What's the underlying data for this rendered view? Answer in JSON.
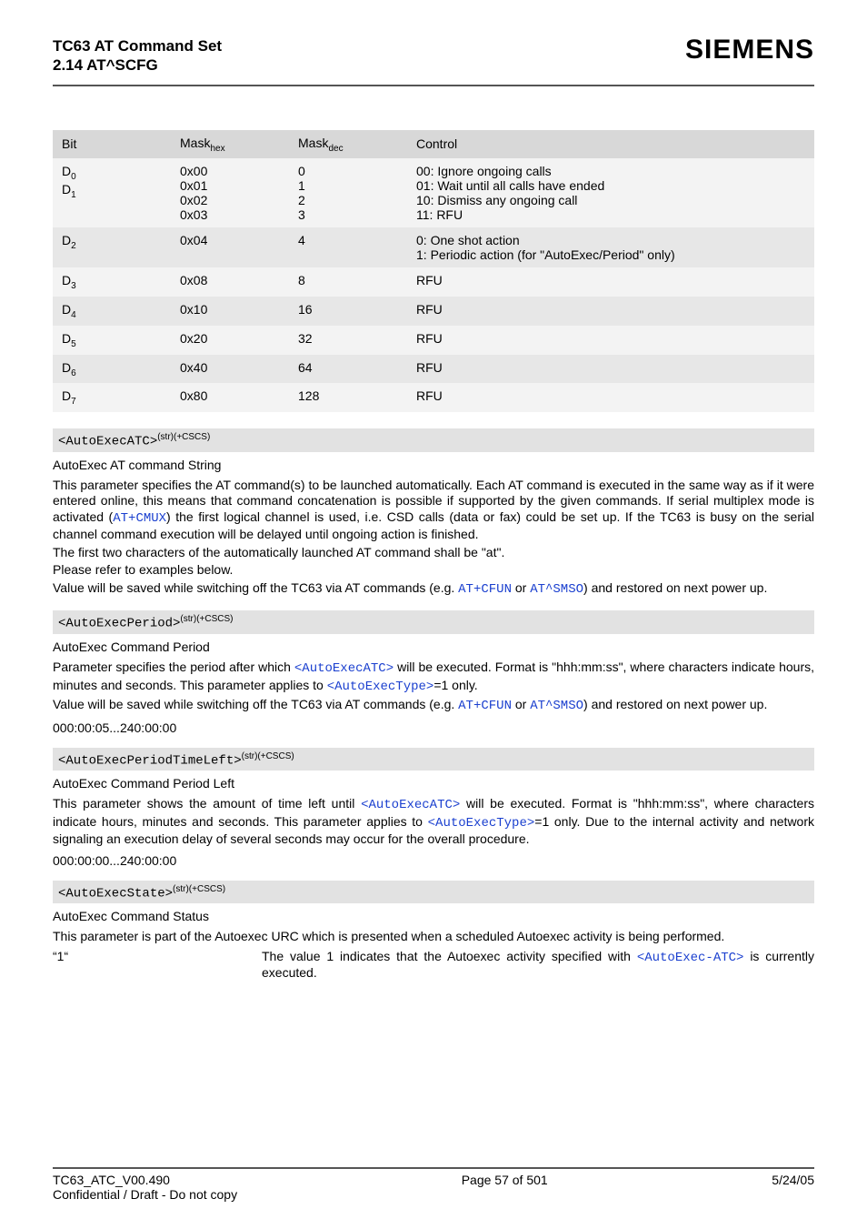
{
  "header": {
    "title": "TC63 AT Command Set",
    "section": "2.14 AT^SCFG",
    "brand": "SIEMENS"
  },
  "table": {
    "headers": {
      "bit": "Bit",
      "hex": "Mask",
      "hex_sub": "hex",
      "dec": "Mask",
      "dec_sub": "dec",
      "control": "Control"
    },
    "rows": [
      {
        "bit_html": "D<sub class='sub'>0</sub><br>D<sub class='sub'>1</sub>",
        "hex": "0x00\n0x01\n0x02\n0x03",
        "dec": "0\n1\n2\n3",
        "control": "00: Ignore ongoing calls\n01: Wait until all calls have ended\n10: Dismiss any ongoing call\n11: RFU",
        "cls": "odd"
      },
      {
        "bit_html": "D<sub class='sub'>2</sub>",
        "hex": "0x04",
        "dec": "4",
        "control": "0: One shot action\n1: Periodic action (for \"AutoExec/Period\" only)",
        "cls": "even"
      },
      {
        "bit_html": "D<sub class='sub'>3</sub>",
        "hex": "0x08",
        "dec": "8",
        "control": "RFU",
        "cls": "odd"
      },
      {
        "bit_html": "D<sub class='sub'>4</sub>",
        "hex": "0x10",
        "dec": "16",
        "control": "RFU",
        "cls": "even"
      },
      {
        "bit_html": "D<sub class='sub'>5</sub>",
        "hex": "0x20",
        "dec": "32",
        "control": "RFU",
        "cls": "odd"
      },
      {
        "bit_html": "D<sub class='sub'>6</sub>",
        "hex": "0x40",
        "dec": "64",
        "control": "RFU",
        "cls": "even"
      },
      {
        "bit_html": "D<sub class='sub'>7</sub>",
        "hex": "0x80",
        "dec": "128",
        "control": "RFU",
        "cls": "odd"
      }
    ]
  },
  "params": {
    "atc": {
      "tag": "<AutoExecATC>",
      "sup": "(str)(+CSCS)",
      "subtitle": "AutoExec AT command String",
      "p1a": "This parameter specifies the AT command(s) to be launched automatically. Each AT command is executed in the same way as if it were entered online, this means that command concatenation is possible if supported by the given commands. If serial multiplex mode is activated (",
      "cmux": "AT+CMUX",
      "p1b": ") the first logical channel is used, i.e. CSD calls (data or fax) could be set up. If the TC63 is busy on the serial channel command execution will be delayed until ongoing action is finished.",
      "p2": "The first two characters of the automatically launched AT command shall be \"at\".",
      "p3": "Please refer to examples below.",
      "p4a": "Value will be saved while switching off the TC63 via AT commands (e.g. ",
      "cfun": "AT+CFUN",
      "or": " or ",
      "smso": "AT^SMSO",
      "p4b": ") and restored on next power up."
    },
    "period": {
      "tag": "<AutoExecPeriod>",
      "sup": "(str)(+CSCS)",
      "subtitle": "AutoExec Command Period",
      "p1a": "Parameter specifies the period after which ",
      "atc_ref": "<AutoExecATC>",
      "p1b": " will be executed. Format is \"hhh:mm:ss\", where characters indicate hours, minutes and seconds. This parameter applies to ",
      "type_ref": "<AutoExecType>",
      "p1c": "=1 only.",
      "p2a": "Value will be saved while switching off the TC63 via AT commands (e.g. ",
      "cfun": "AT+CFUN",
      "or": " or ",
      "smso": "AT^SMSO",
      "p2b": ") and restored on next power up.",
      "range": "000:00:05...240:00:00"
    },
    "period_left": {
      "tag": "<AutoExecPeriodTimeLeft>",
      "sup": "(str)(+CSCS)",
      "subtitle": "AutoExec Command Period Left",
      "p1a": "This parameter shows the amount of time left until ",
      "atc_ref": "<AutoExecATC>",
      "p1b": " will be executed. Format is \"hhh:mm:ss\", where characters indicate hours, minutes and seconds. This parameter applies to ",
      "type_ref": "<AutoExecType>",
      "p1c": "=1 only. Due to the internal activity and network signaling an execution delay of several seconds may occur for the overall procedure.",
      "range": "000:00:00...240:00:00"
    },
    "state": {
      "tag": "<AutoExecState>",
      "sup": "(str)(+CSCS)",
      "subtitle": "AutoExec Command Status",
      "p1": "This parameter is part of the Autoexec URC which is presented when a scheduled Autoexec activity is being performed.",
      "key": "“1“",
      "val_a": "The value 1 indicates that the Autoexec activity specified with ",
      "atc_ref": "<AutoExec-ATC>",
      "val_b": " is currently executed."
    }
  },
  "footer": {
    "doc_id": "TC63_ATC_V00.490",
    "page": "Page 57 of 501",
    "date": "5/24/05",
    "conf": "Confidential / Draft - Do not copy"
  }
}
